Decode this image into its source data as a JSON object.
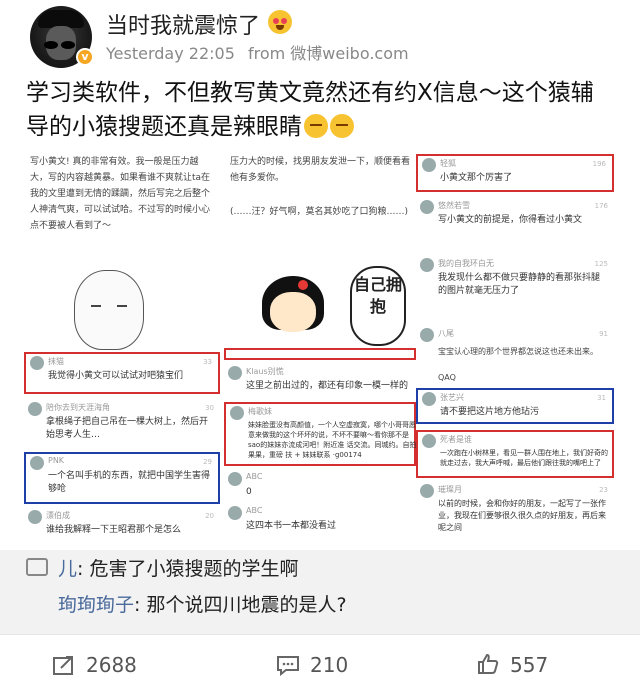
{
  "post": {
    "username": "当时我就震惊了",
    "time": "Yesterday 22:05",
    "source": "from 微博weibo.com",
    "text": "学习类软件，不但教写黄文竟然还有约X信息～这个猿辅导的小猿搜题还真是辣眼睛"
  },
  "collage": {
    "col1_text": "写小黄文! 真的非常有效。我一般是压力越大，写的内容越黄暴。如果看谁不爽就让ta在我的文里遭到无情的蹂躏，然后写完之后整个人神清气爽，可以试试哈。不过写的时候小心点不要被人看到了～",
    "col1_comments": [
      {
        "name": "抹猫",
        "text": "我觉得小黄文可以试试对吧猿宝们",
        "likes": "33"
      },
      {
        "name": "陪你去到天涯海角",
        "text": "拿根绳子把自己吊在一棵大树上，然后开始思考人生…",
        "likes": "30"
      },
      {
        "name": "PNK",
        "text": "一个名叫手机的东西，就把中国学生害得够呛",
        "likes": "29"
      },
      {
        "name": "漂伯成",
        "text": "谁给我解释一下王昭君那个是怎么",
        "likes": "20"
      }
    ],
    "col2_text": "压力大的时候，找男朋友发泄一下，顺便看看他有多爱你。",
    "col2_text2": "(……汪？好气啊，莫名其妙吃了口狗粮……)",
    "col2_bubble": "自己拥抱",
    "col2_comments": [
      {
        "name": "Klaus别慌",
        "text": "这里之前出过的，都还有印象一模一样的",
        "likes": ""
      },
      {
        "name": "梅歌妹",
        "text": "妹妹脸蛋没有高颜值，一个人空虚寂寞，哪个小哥哥愿意来做我的这个坏坏的说，不坏不要嘛～看你那不是sao的妹妹亦流成河吧！附近准 话交流。同城约。自拍 果果，重磅 扶 + 妹妹联系 ·g00174",
        "likes": ""
      },
      {
        "name": "ABC",
        "text": "0",
        "likes": ""
      },
      {
        "name": "ABC",
        "text": "这四本书一本都没看过",
        "likes": ""
      }
    ],
    "col3_comments": [
      {
        "name": "轻狐",
        "text": "小黄文那个厉害了",
        "likes": "196"
      },
      {
        "name": "悠然若雪",
        "text": "写小黄文的前提是，你得看过小黄文",
        "likes": "176"
      },
      {
        "name": "我的自我环白无",
        "text": "我发现什么都不做只要静静的看那张抖腿的图片就毫无压力了",
        "likes": "125"
      },
      {
        "name": "八尾",
        "text": "",
        "likes": "91"
      },
      {
        "name": "",
        "text": "宝宝认心理的那个世界都怎说这也还未出来。",
        "likes": ""
      },
      {
        "name": "",
        "text": "QAQ",
        "likes": ""
      },
      {
        "name": "张艺兴",
        "text": "请不要把这片地方他玷污",
        "likes": "31"
      },
      {
        "name": "死者是谁",
        "text": "一次跑在小树林里，看见一群人围在地上，我们好奇的就走过去，我大声呼喊，最后他们跟往我的嘴吧上了",
        "likes": ""
      },
      {
        "name": "璀璨月",
        "text": "以前的时候，会和你好的朋友，一起写了一张作业，我现在们要够很久很久点的好朋友，再后来呢之间",
        "likes": "23"
      }
    ]
  },
  "comments": [
    {
      "who": "儿",
      "text": "危害了小猿搜题的学生啊"
    },
    {
      "who": "珣珣珣子",
      "text": "那个说四川地震的是人?"
    }
  ],
  "actions": {
    "repost": "2688",
    "comment": "210",
    "like": "557"
  }
}
